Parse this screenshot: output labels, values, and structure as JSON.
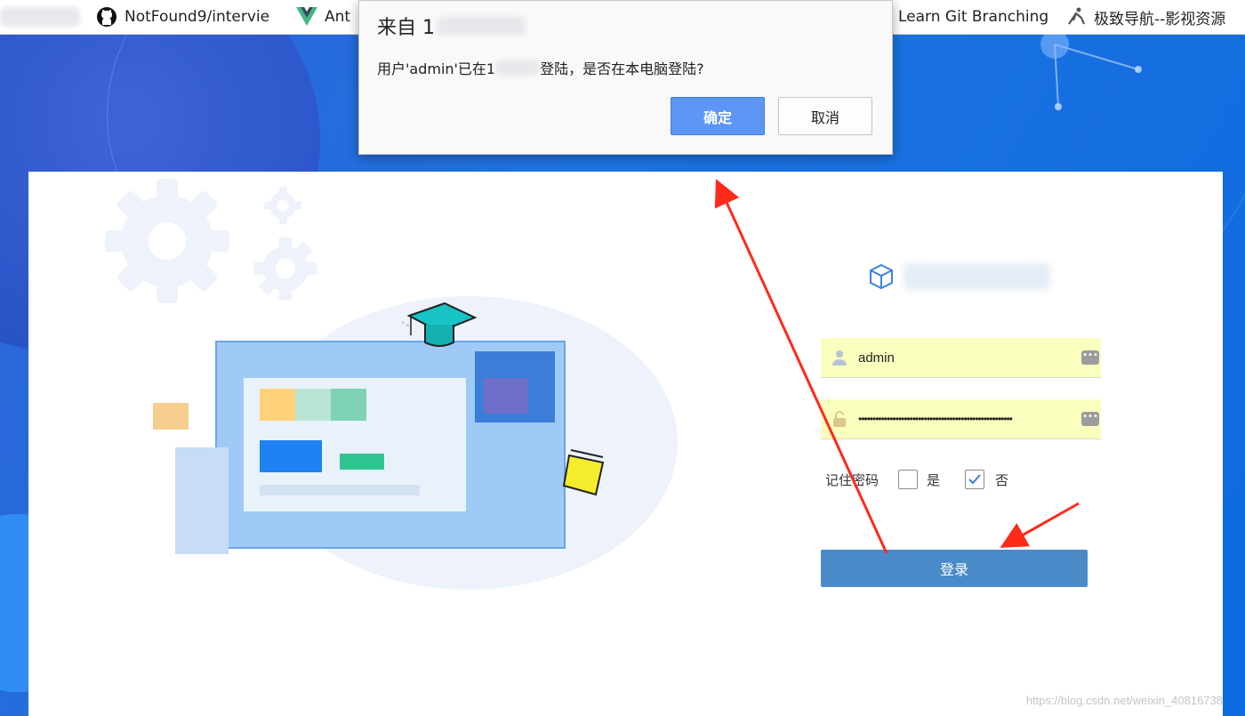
{
  "bookmarks": [
    {
      "label": "NotFound9/intervie",
      "icon": "github-icon"
    },
    {
      "label": "Ant",
      "icon": "vue-icon"
    },
    {
      "label": "Learn Git Branching",
      "icon": ""
    },
    {
      "label": "极致导航--影视资源",
      "icon": "yoga-icon"
    }
  ],
  "dialog": {
    "title": "来自 1",
    "message_prefix": "用户'admin'已在1",
    "message_suffix": "登陆，是否在本电脑登陆?",
    "ok_label": "确定",
    "cancel_label": "取消"
  },
  "login": {
    "username_value": "admin",
    "password_value": "••••••••••••••••••••••••••••••••••••••••••••••••••••••",
    "remember_label": "记住密码",
    "remember_yes_label": "是",
    "remember_no_label": "否",
    "remember_yes_checked": false,
    "remember_no_checked": true,
    "submit_label": "登录"
  },
  "watermark": "https://blog.csdn.net/weixin_40816738",
  "colors": {
    "background_blue": "#1a6ad8",
    "login_button": "#4a8ac8",
    "autofill_yellow": "#faffbd",
    "dialog_ok": "#5d96f5",
    "arrow_red": "#ff2a1a"
  }
}
